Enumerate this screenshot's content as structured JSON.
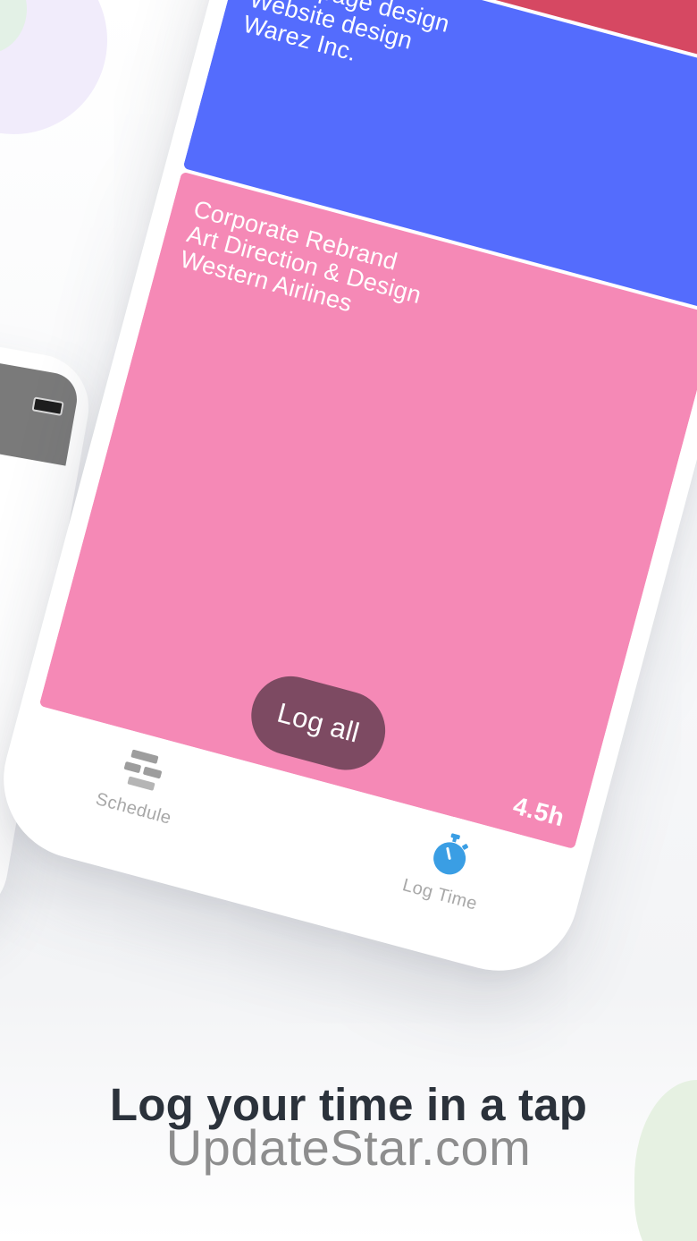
{
  "cards": [
    {
      "color": "#d64862",
      "lines": []
    },
    {
      "color": "#546cfd",
      "lines": [
        "Homepage design",
        "Website design",
        "Warez Inc."
      ]
    },
    {
      "color": "#f589b6",
      "lines": [
        "Corporate Rebrand",
        "Art Direction & Design",
        "Western Airlines"
      ],
      "hours": "4.5h"
    }
  ],
  "log_all_label": "Log all",
  "tabs": [
    {
      "label": "Schedule",
      "icon": "schedule-icon",
      "active": false
    },
    {
      "label": "Log Time",
      "icon": "stopwatch-icon",
      "active": true
    }
  ],
  "colors": {
    "log_all_button": "#7d4a62",
    "active_tab_icon": "#3a9ee4",
    "inactive_tab": "#a8a8a8"
  },
  "headline": "Log your time in a tap",
  "watermark": "UpdateStar.com"
}
